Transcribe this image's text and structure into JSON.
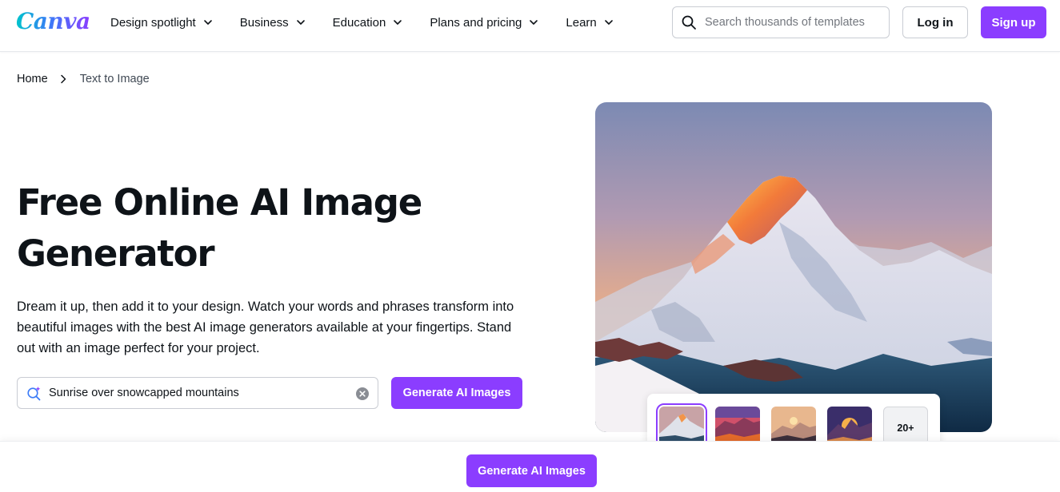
{
  "header": {
    "logo": "Canva",
    "nav": [
      {
        "label": "Design spotlight",
        "icon": "chevron-down-icon"
      },
      {
        "label": "Business",
        "icon": "chevron-down-icon"
      },
      {
        "label": "Education",
        "icon": "chevron-down-icon"
      },
      {
        "label": "Plans and pricing",
        "icon": "chevron-down-icon"
      },
      {
        "label": "Learn",
        "icon": "chevron-down-icon"
      }
    ],
    "search": {
      "placeholder": "Search thousands of templates",
      "value": "",
      "icon": "search-icon"
    },
    "login_label": "Log in",
    "signup_label": "Sign up"
  },
  "breadcrumb": {
    "home": "Home",
    "current": "Text to Image",
    "separator_icon": "chevron-right-icon"
  },
  "hero": {
    "title_line1": "Free Online AI Image",
    "title_line2": "Generator",
    "description": "Dream it up, then add it to your design. Watch your words and phrases transform into beautiful images with the best AI image generators available at your fingertips. Stand out with an image perfect for your project.",
    "prompt": {
      "value": "Sunrise over snowcapped mountains",
      "icon": "magic-search-icon",
      "clear_icon": "clear-icon"
    },
    "generate_label": "Generate AI Images"
  },
  "gallery": {
    "thumbnails": [
      "mountain-sunrise-1",
      "mountain-sunset-2",
      "mountain-dawn-3",
      "mountain-glow-4"
    ],
    "selected_index": 0,
    "more_label": "20+"
  },
  "sticky_bar": {
    "generate_label": "Generate AI Images"
  },
  "colors": {
    "accent": "#8b3dff",
    "text": "#0e1318",
    "border": "#c9ccd3"
  }
}
